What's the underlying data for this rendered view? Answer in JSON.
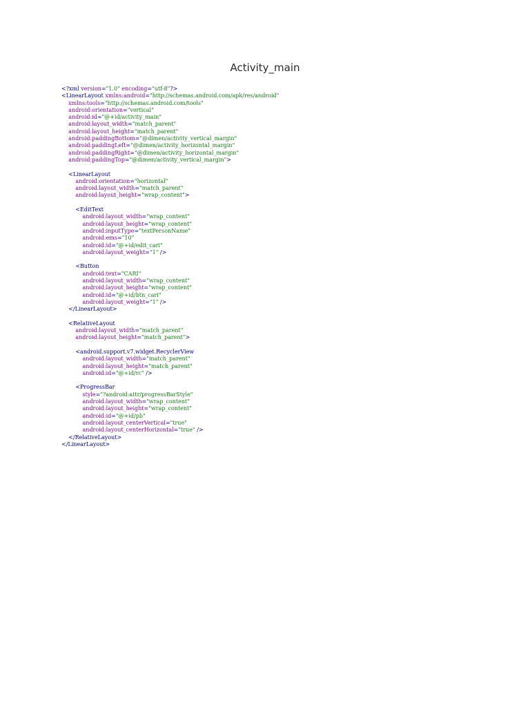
{
  "title": "Activity_main",
  "colors": {
    "tag": "#000080",
    "attribute": "#7a0b8a",
    "value": "#1a7a1a"
  },
  "lines": [
    {
      "indent": 0,
      "parts": [
        [
          "tag",
          "<?xml "
        ],
        [
          "attr",
          "version"
        ],
        [
          "punct",
          "="
        ],
        [
          "val",
          "\"1.0\""
        ],
        [
          "punct",
          " "
        ],
        [
          "attr",
          "encoding"
        ],
        [
          "punct",
          "="
        ],
        [
          "val",
          "\"utf-8\""
        ],
        [
          "tag",
          "?>"
        ]
      ]
    },
    {
      "indent": 0,
      "parts": [
        [
          "tag",
          "<LinearLayout "
        ],
        [
          "attr",
          "xmlns:android"
        ],
        [
          "punct",
          "="
        ],
        [
          "val",
          "\"http://schemas.android.com/apk/res/android\""
        ]
      ]
    },
    {
      "indent": 1,
      "parts": [
        [
          "attr",
          "xmlns:tools"
        ],
        [
          "punct",
          "="
        ],
        [
          "val",
          "\"http://schemas.android.com/tools\""
        ]
      ]
    },
    {
      "indent": 1,
      "parts": [
        [
          "attr",
          "android:orientation"
        ],
        [
          "punct",
          "="
        ],
        [
          "val",
          "\"vertical\""
        ]
      ]
    },
    {
      "indent": 1,
      "parts": [
        [
          "attr",
          "android:id"
        ],
        [
          "punct",
          "="
        ],
        [
          "val",
          "\"@+id/activity_main\""
        ]
      ]
    },
    {
      "indent": 1,
      "parts": [
        [
          "attr",
          "android:layout_width"
        ],
        [
          "punct",
          "="
        ],
        [
          "val",
          "\"match_parent\""
        ]
      ]
    },
    {
      "indent": 1,
      "parts": [
        [
          "attr",
          "android:layout_height"
        ],
        [
          "punct",
          "="
        ],
        [
          "val",
          "\"match_parent\""
        ]
      ]
    },
    {
      "indent": 1,
      "parts": [
        [
          "attr",
          "android:paddingBottom"
        ],
        [
          "punct",
          "="
        ],
        [
          "val",
          "\"@dimen/activity_vertical_margin\""
        ]
      ]
    },
    {
      "indent": 1,
      "parts": [
        [
          "attr",
          "android:paddingLeft"
        ],
        [
          "punct",
          "="
        ],
        [
          "val",
          "\"@dimen/activity_horizontal_margin\""
        ]
      ]
    },
    {
      "indent": 1,
      "parts": [
        [
          "attr",
          "android:paddingRight"
        ],
        [
          "punct",
          "="
        ],
        [
          "val",
          "\"@dimen/activity_horizontal_margin\""
        ]
      ]
    },
    {
      "indent": 1,
      "parts": [
        [
          "attr",
          "android:paddingTop"
        ],
        [
          "punct",
          "="
        ],
        [
          "val",
          "\"@dimen/activity_vertical_margin\""
        ],
        [
          "tag",
          ">"
        ]
      ]
    },
    {
      "indent": 0,
      "parts": []
    },
    {
      "indent": 1,
      "parts": [
        [
          "tag",
          "<LinearLayout"
        ]
      ]
    },
    {
      "indent": 2,
      "parts": [
        [
          "attr",
          "android:orientation"
        ],
        [
          "punct",
          "="
        ],
        [
          "val",
          "\"horizontal\""
        ]
      ]
    },
    {
      "indent": 2,
      "parts": [
        [
          "attr",
          "android:layout_width"
        ],
        [
          "punct",
          "="
        ],
        [
          "val",
          "\"match_parent\""
        ]
      ]
    },
    {
      "indent": 2,
      "parts": [
        [
          "attr",
          "android:layout_height"
        ],
        [
          "punct",
          "="
        ],
        [
          "val",
          "\"wrap_content\""
        ],
        [
          "tag",
          ">"
        ]
      ]
    },
    {
      "indent": 0,
      "parts": []
    },
    {
      "indent": 2,
      "parts": [
        [
          "tag",
          "<EditText"
        ]
      ]
    },
    {
      "indent": 3,
      "parts": [
        [
          "attr",
          "android:layout_width"
        ],
        [
          "punct",
          "="
        ],
        [
          "val",
          "\"wrap_content\""
        ]
      ]
    },
    {
      "indent": 3,
      "parts": [
        [
          "attr",
          "android:layout_height"
        ],
        [
          "punct",
          "="
        ],
        [
          "val",
          "\"wrap_content\""
        ]
      ]
    },
    {
      "indent": 3,
      "parts": [
        [
          "attr",
          "android:inputType"
        ],
        [
          "punct",
          "="
        ],
        [
          "val",
          "\"textPersonName\""
        ]
      ]
    },
    {
      "indent": 3,
      "parts": [
        [
          "attr",
          "android:ems"
        ],
        [
          "punct",
          "="
        ],
        [
          "val",
          "\"10\""
        ]
      ]
    },
    {
      "indent": 3,
      "parts": [
        [
          "attr",
          "android:id"
        ],
        [
          "punct",
          "="
        ],
        [
          "val",
          "\"@+id/edit_cari\""
        ]
      ]
    },
    {
      "indent": 3,
      "parts": [
        [
          "attr",
          "android:layout_weight"
        ],
        [
          "punct",
          "="
        ],
        [
          "val",
          "\"1\""
        ],
        [
          "tag",
          " />"
        ]
      ]
    },
    {
      "indent": 0,
      "parts": []
    },
    {
      "indent": 2,
      "parts": [
        [
          "tag",
          "<Button"
        ]
      ]
    },
    {
      "indent": 3,
      "parts": [
        [
          "attr",
          "android:text"
        ],
        [
          "punct",
          "="
        ],
        [
          "val",
          "\"CARI\""
        ]
      ]
    },
    {
      "indent": 3,
      "parts": [
        [
          "attr",
          "android:layout_width"
        ],
        [
          "punct",
          "="
        ],
        [
          "val",
          "\"wrap_content\""
        ]
      ]
    },
    {
      "indent": 3,
      "parts": [
        [
          "attr",
          "android:layout_height"
        ],
        [
          "punct",
          "="
        ],
        [
          "val",
          "\"wrap_content\""
        ]
      ]
    },
    {
      "indent": 3,
      "parts": [
        [
          "attr",
          "android:id"
        ],
        [
          "punct",
          "="
        ],
        [
          "val",
          "\"@+id/btn_cari\""
        ]
      ]
    },
    {
      "indent": 3,
      "parts": [
        [
          "attr",
          "android:layout_weight"
        ],
        [
          "punct",
          "="
        ],
        [
          "val",
          "\"1\""
        ],
        [
          "tag",
          " />"
        ]
      ]
    },
    {
      "indent": 1,
      "parts": [
        [
          "tag",
          "</LinearLayout>"
        ]
      ]
    },
    {
      "indent": 0,
      "parts": []
    },
    {
      "indent": 1,
      "parts": [
        [
          "tag",
          "<RelativeLayout"
        ]
      ]
    },
    {
      "indent": 2,
      "parts": [
        [
          "attr",
          "android:layout_width"
        ],
        [
          "punct",
          "="
        ],
        [
          "val",
          "\"match_parent\""
        ]
      ]
    },
    {
      "indent": 2,
      "parts": [
        [
          "attr",
          "android:layout_height"
        ],
        [
          "punct",
          "="
        ],
        [
          "val",
          "\"match_parent\""
        ],
        [
          "tag",
          ">"
        ]
      ]
    },
    {
      "indent": 0,
      "parts": []
    },
    {
      "indent": 2,
      "parts": [
        [
          "tag",
          "<android.support.v7.widget.RecyclerView"
        ]
      ]
    },
    {
      "indent": 3,
      "parts": [
        [
          "attr",
          "android:layout_width"
        ],
        [
          "punct",
          "="
        ],
        [
          "val",
          "\"match_parent\""
        ]
      ]
    },
    {
      "indent": 3,
      "parts": [
        [
          "attr",
          "android:layout_height"
        ],
        [
          "punct",
          "="
        ],
        [
          "val",
          "\"match_parent\""
        ]
      ]
    },
    {
      "indent": 3,
      "parts": [
        [
          "attr",
          "android:id"
        ],
        [
          "punct",
          "="
        ],
        [
          "val",
          "\"@+id/rc\""
        ],
        [
          "tag",
          " />"
        ]
      ]
    },
    {
      "indent": 0,
      "parts": []
    },
    {
      "indent": 2,
      "parts": [
        [
          "tag",
          "<ProgressBar"
        ]
      ]
    },
    {
      "indent": 3,
      "parts": [
        [
          "attr",
          "style"
        ],
        [
          "punct",
          "="
        ],
        [
          "val",
          "\"?android:attr/progressBarStyle\""
        ]
      ]
    },
    {
      "indent": 3,
      "parts": [
        [
          "attr",
          "android:layout_width"
        ],
        [
          "punct",
          "="
        ],
        [
          "val",
          "\"wrap_content\""
        ]
      ]
    },
    {
      "indent": 3,
      "parts": [
        [
          "attr",
          "android:layout_height"
        ],
        [
          "punct",
          "="
        ],
        [
          "val",
          "\"wrap_content\""
        ]
      ]
    },
    {
      "indent": 3,
      "parts": [
        [
          "attr",
          "android:id"
        ],
        [
          "punct",
          "="
        ],
        [
          "val",
          "\"@+id/pb\""
        ]
      ]
    },
    {
      "indent": 3,
      "parts": [
        [
          "attr",
          "android:layout_centerVertical"
        ],
        [
          "punct",
          "="
        ],
        [
          "val",
          "\"true\""
        ]
      ]
    },
    {
      "indent": 3,
      "parts": [
        [
          "attr",
          "android:layout_centerHorizontal"
        ],
        [
          "punct",
          "="
        ],
        [
          "val",
          "\"true\""
        ],
        [
          "tag",
          " />"
        ]
      ]
    },
    {
      "indent": 1,
      "parts": [
        [
          "tag",
          "</RelativeLayout>"
        ]
      ]
    },
    {
      "indent": 0,
      "parts": [
        [
          "tag",
          "</LinearLayout>"
        ]
      ]
    }
  ]
}
